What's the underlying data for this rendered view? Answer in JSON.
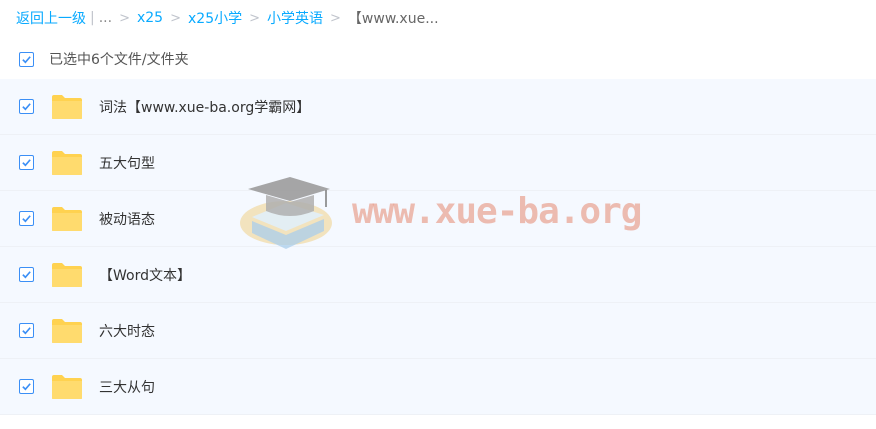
{
  "breadcrumb": {
    "back": "返回上一级",
    "ellipsis": "...",
    "items": [
      "x25",
      "x25小学",
      "小学英语"
    ],
    "current": "【www.xue...",
    "sep": ">"
  },
  "selection": {
    "label": "已选中6个文件/文件夹",
    "checked": true
  },
  "files": [
    {
      "name": "词法【www.xue-ba.org学霸网】",
      "type": "folder",
      "checked": true
    },
    {
      "name": "五大句型",
      "type": "folder",
      "checked": true
    },
    {
      "name": "被动语态",
      "type": "folder",
      "checked": true
    },
    {
      "name": "【Word文本】",
      "type": "folder",
      "checked": true
    },
    {
      "name": "六大时态",
      "type": "folder",
      "checked": true
    },
    {
      "name": "三大从句",
      "type": "folder",
      "checked": true
    }
  ],
  "watermark": {
    "text": "www.xue-ba.org",
    "icon": "graduation-cap-book-icon"
  },
  "colors": {
    "link": "#09aaff",
    "checkbox": "#3b8ff6",
    "folder": "#ffd250",
    "row_bg": "#f5f9ff"
  }
}
